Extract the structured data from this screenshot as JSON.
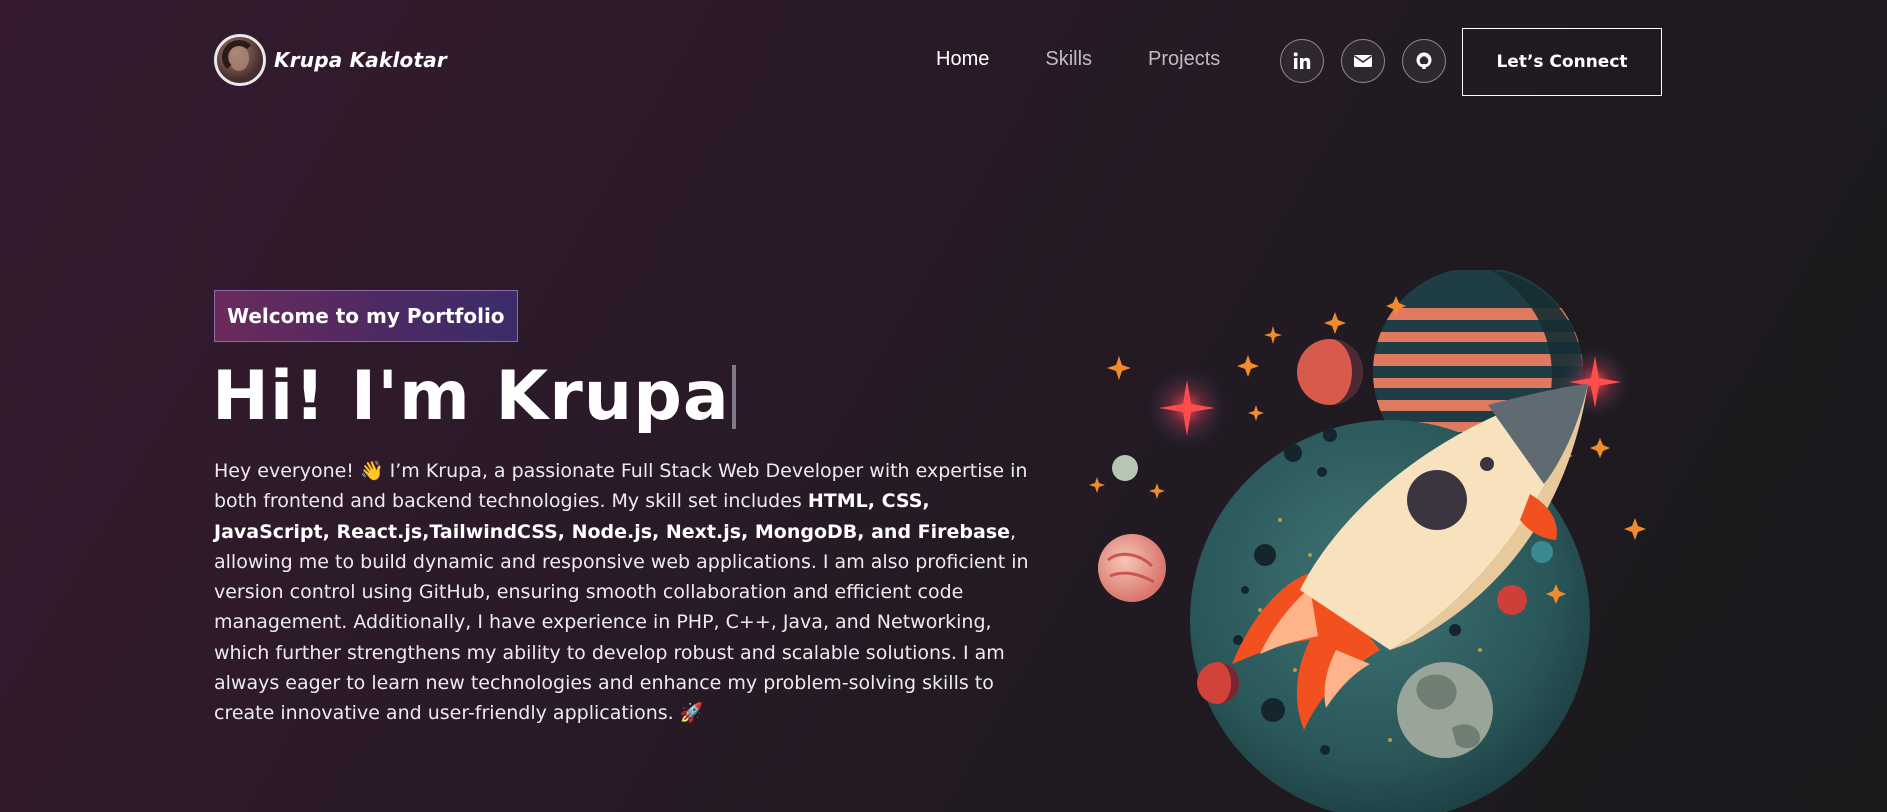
{
  "brand": {
    "name": "Krupa Kaklotar"
  },
  "nav": {
    "links": [
      {
        "label": "Home",
        "active": true
      },
      {
        "label": "Skills",
        "active": false
      },
      {
        "label": "Projects",
        "active": false
      }
    ],
    "socials": [
      "linkedin-icon",
      "email-icon",
      "github-icon"
    ],
    "connect_label": "Let’s Connect"
  },
  "hero": {
    "tagline": "Welcome to my Portfolio",
    "title": "Hi! I'm Krupa",
    "intro": {
      "p1": "Hey everyone! 👋 I’m Krupa, a passionate Full Stack Web Developer with expertise in both frontend and backend technologies. My skill set includes ",
      "skills": "HTML, CSS, JavaScript, React.js,TailwindCSS, Node.js, Next.js, MongoDB, and Firebase",
      "p2": ", allowing me to build dynamic and responsive web applications. I am also proficient in version control using GitHub, ensuring smooth collaboration and efficient code management. Additionally, I have experience in PHP, C++, Java, and Networking, which further strengthens my ability to develop robust and scalable solutions. I am always eager to learn new technologies and enhance my problem-solving skills to create innovative and user-friendly applications. 🚀"
    }
  },
  "colors": {
    "background": "#2b1a29",
    "tagline_gradient_start": "#6b2a5c",
    "tagline_gradient_end": "#3b2c6a",
    "rocket_flame": "#f2501e",
    "rocket_body": "#f7e2bd",
    "planet_main": "#2d5c5e"
  }
}
